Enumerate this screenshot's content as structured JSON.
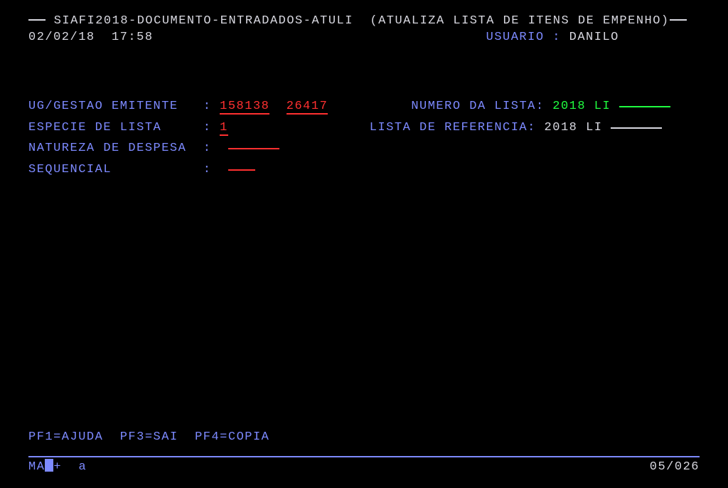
{
  "header": {
    "title": "SIAFI2018-DOCUMENTO-ENTRADADOS-ATULI  (ATUALIZA LISTA DE ITENS DE EMPENHO)",
    "date": "02/02/18",
    "time": "17:58",
    "usuario_label": "USUARIO :",
    "usuario": "DANILO"
  },
  "form": {
    "ug_gestao_label": "UG/GESTAO EMITENTE",
    "ug_value": "158138",
    "gestao_value": "26417",
    "numero_lista_label": "NUMERO DA LISTA:",
    "numero_lista_year": "2018",
    "numero_lista_type": "LI",
    "especie_label": "ESPECIE DE LISTA",
    "especie_value": "1",
    "lista_ref_label": "LISTA DE REFERENCIA:",
    "lista_ref_year": "2018",
    "lista_ref_type": "LI",
    "natureza_label": "NATUREZA DE DESPESA",
    "sequencial_label": "SEQUENCIAL"
  },
  "fkeys": {
    "pf1": "PF1=AJUDA",
    "pf3": "PF3=SAI",
    "pf4": "PF4=COPIA"
  },
  "status": {
    "indicator": "MA",
    "plus": "+",
    "letter": "a",
    "position": "05/026"
  }
}
